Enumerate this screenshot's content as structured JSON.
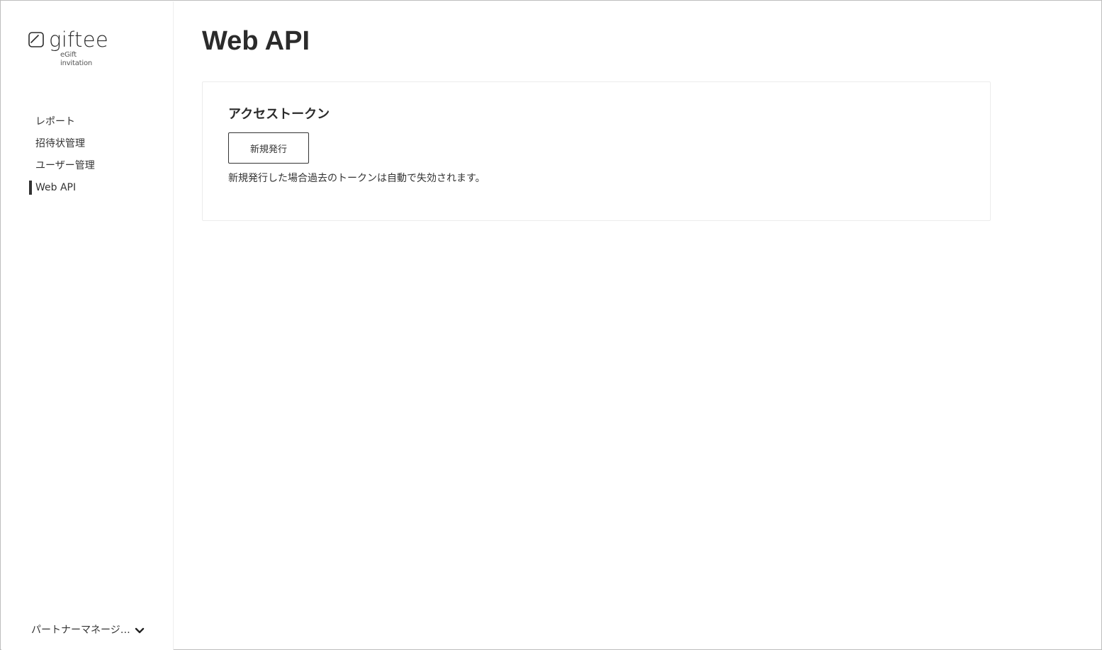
{
  "brand": {
    "name": "giftee",
    "tagline": "eGift invitation",
    "logo_icon": "giftee-logo-icon"
  },
  "sidebar": {
    "items": [
      {
        "label": "レポート",
        "active": false
      },
      {
        "label": "招待状管理",
        "active": false
      },
      {
        "label": "ユーザー管理",
        "active": false
      },
      {
        "label": "Web API",
        "active": true
      }
    ],
    "account": {
      "label": "パートナーマネージ…",
      "icon": "chevron-down-icon"
    }
  },
  "page": {
    "title": "Web API"
  },
  "access_token": {
    "title": "アクセストークン",
    "issue_button_label": "新規発行",
    "note": "新規発行した場合過去のトークンは自動で失効されます。"
  }
}
